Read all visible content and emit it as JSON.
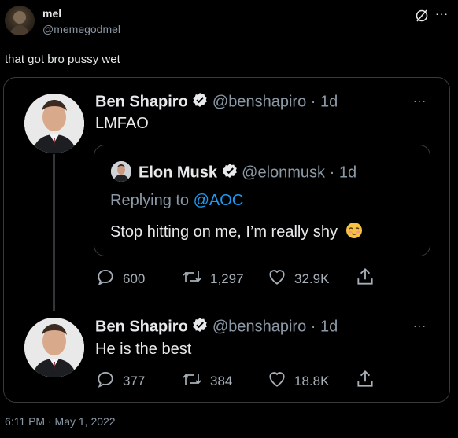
{
  "header": {
    "display_name": "mel",
    "handle": "@memegodmel",
    "tweet_text": "that got bro pussy wet"
  },
  "embedded": {
    "top": {
      "name": "Ben Shapiro",
      "handle": "@benshapiro",
      "time": "· 1d",
      "text": "LMFAO"
    },
    "quote": {
      "name": "Elon Musk",
      "handle": "@elonmusk",
      "time": "· 1d",
      "replying_prefix": "Replying to",
      "replying_to": "@AOC",
      "text": "Stop hitting on me, I’m really shy",
      "emoji": "☺️"
    },
    "top_stats": {
      "replies": "600",
      "retweets": "1,297",
      "likes": "32.9K"
    },
    "reply": {
      "name": "Ben Shapiro",
      "handle": "@benshapiro",
      "time": "· 1d",
      "text": "He is the best"
    },
    "reply_stats": {
      "replies": "377",
      "retweets": "384",
      "likes": "18.8K"
    }
  },
  "footer": {
    "timestamp": "6:11 PM · May 1, 2022"
  },
  "colors": {
    "background": "#000000",
    "accent": "#1d9bf0",
    "muted": "#8b98a5",
    "border": "#3a3a3a"
  },
  "icons": [
    "avatar",
    "verified-badge-icon",
    "more-icon",
    "reply-icon",
    "retweet-icon",
    "like-icon",
    "share-icon",
    "no-reply-icon"
  ]
}
